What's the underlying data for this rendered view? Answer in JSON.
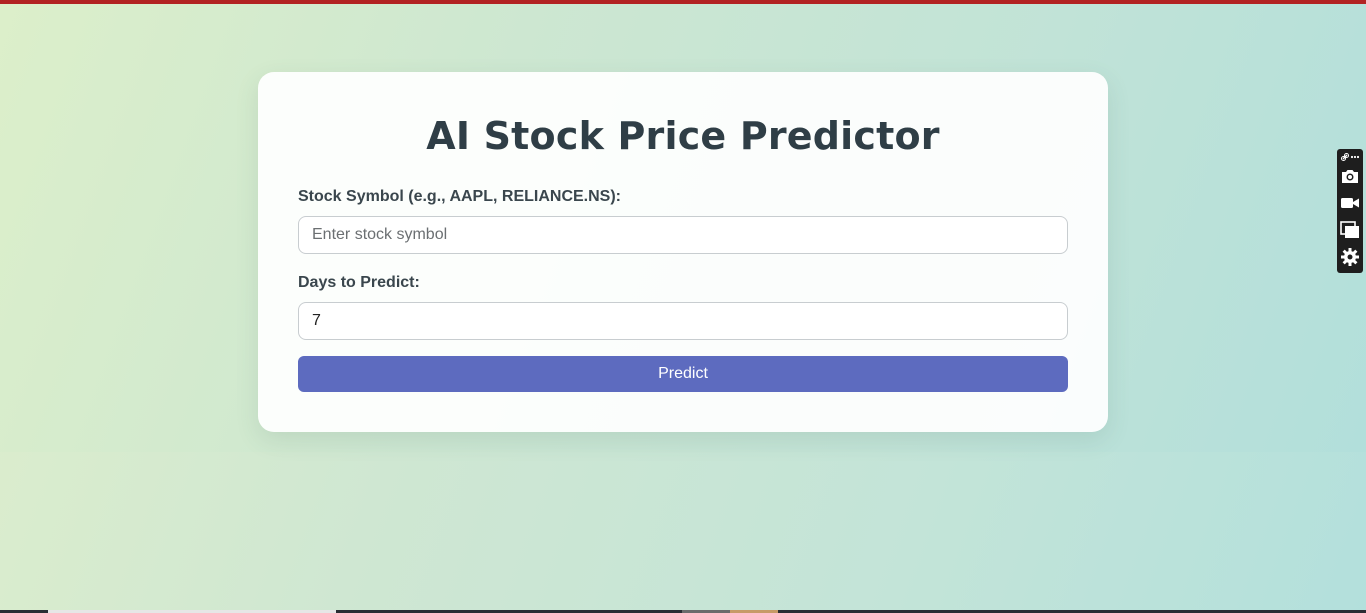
{
  "page": {
    "title": "AI Stock Price Predictor"
  },
  "form": {
    "symbol_label": "Stock Symbol (e.g., AAPL, RELIANCE.NS):",
    "symbol_placeholder": "Enter stock symbol",
    "symbol_value": "",
    "days_label": "Days to Predict:",
    "days_value": "7",
    "predict_label": "Predict"
  },
  "side_toolbar": {
    "icons": [
      "link-icon",
      "more-icon",
      "camera-icon",
      "video-camera-icon",
      "window-icon",
      "settings-icon"
    ]
  },
  "colors": {
    "accent_bar": "#b22222",
    "button": "#5d6bbf",
    "title": "#2f3e46"
  }
}
